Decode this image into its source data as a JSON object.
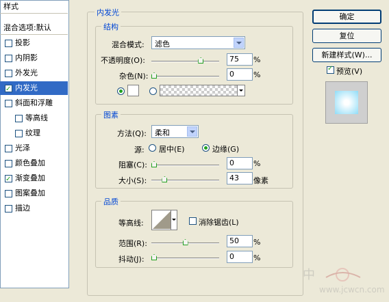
{
  "styles": {
    "header": "样式",
    "blend_options": "混合选项:默认",
    "items": [
      {
        "label": "投影",
        "checked": false,
        "selected": false,
        "sub": false
      },
      {
        "label": "内阴影",
        "checked": false,
        "selected": false,
        "sub": false
      },
      {
        "label": "外发光",
        "checked": false,
        "selected": false,
        "sub": false
      },
      {
        "label": "内发光",
        "checked": true,
        "selected": true,
        "sub": false
      },
      {
        "label": "斜面和浮雕",
        "checked": false,
        "selected": false,
        "sub": false
      },
      {
        "label": "等高线",
        "checked": false,
        "selected": false,
        "sub": true
      },
      {
        "label": "纹理",
        "checked": false,
        "selected": false,
        "sub": true
      },
      {
        "label": "光泽",
        "checked": false,
        "selected": false,
        "sub": false
      },
      {
        "label": "颜色叠加",
        "checked": false,
        "selected": false,
        "sub": false
      },
      {
        "label": "渐变叠加",
        "checked": true,
        "selected": false,
        "sub": false
      },
      {
        "label": "图案叠加",
        "checked": false,
        "selected": false,
        "sub": false
      },
      {
        "label": "描边",
        "checked": false,
        "selected": false,
        "sub": false
      }
    ]
  },
  "inner_glow": {
    "title": "内发光",
    "structure": {
      "title": "结构",
      "blend_mode_label": "混合模式:",
      "blend_mode_value": "滤色",
      "opacity_label": "不透明度(O):",
      "opacity_value": "75",
      "opacity_unit": "%",
      "opacity_fraction": 0.75,
      "noise_label": "杂色(N):",
      "noise_value": "0",
      "noise_unit": "%",
      "noise_fraction": 0.0
    },
    "elements": {
      "title": "图素",
      "method_label": "方法(Q):",
      "method_value": "柔和",
      "source_label": "源:",
      "source_center": "居中(E)",
      "source_edge": "边缘(G)",
      "choke_label": "阻塞(C):",
      "choke_value": "0",
      "choke_unit": "%",
      "choke_fraction": 0.0,
      "size_label": "大小(S):",
      "size_value": "43",
      "size_unit": "像素",
      "size_fraction": 0.17
    },
    "quality": {
      "title": "品质",
      "contour_label": "等高线:",
      "anti_alias_label": "消除锯齿(L)",
      "range_label": "范围(R):",
      "range_value": "50",
      "range_unit": "%",
      "range_fraction": 0.5,
      "jitter_label": "抖动(J):",
      "jitter_value": "0",
      "jitter_unit": "%",
      "jitter_fraction": 0.0
    }
  },
  "buttons": {
    "ok": "确定",
    "reset": "复位",
    "new_style": "新建样式(W)...",
    "preview_label": "预览(V)"
  },
  "colors": {
    "selection": "#316ac5",
    "preview_glow": "#8fdcf7",
    "accent_text": "#0046d5"
  }
}
